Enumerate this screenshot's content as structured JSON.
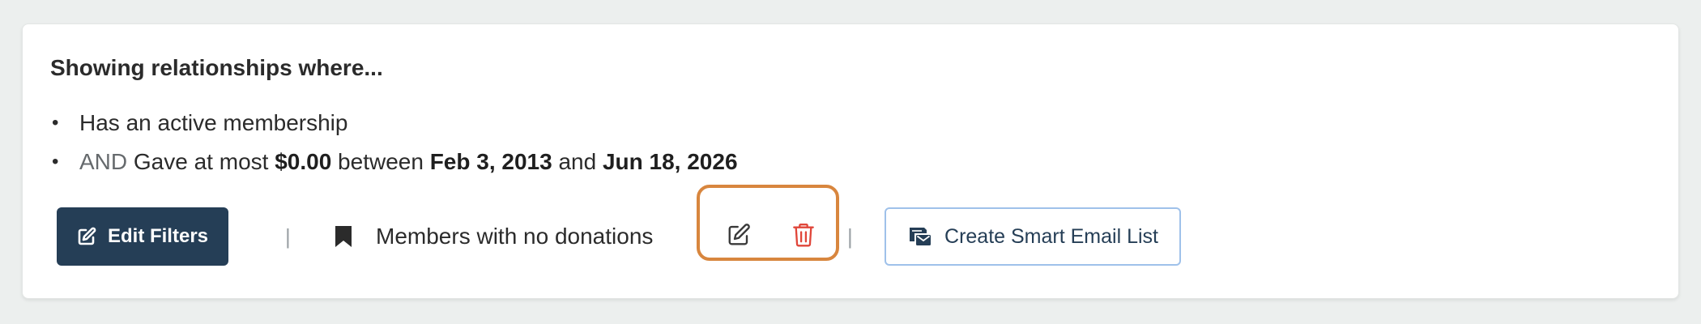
{
  "heading": "Showing relationships where...",
  "conditions": [
    {
      "bullet": "•",
      "text": "Has an active membership"
    },
    {
      "bullet": "•",
      "prefix": "AND",
      "text_before_amount": " Gave at most ",
      "amount": "$0.00",
      "text_between": " between ",
      "start_date": "Feb 3, 2013",
      "text_and": " and ",
      "end_date": "Jun 18, 2026"
    }
  ],
  "actions": {
    "edit_filters_label": "Edit Filters",
    "edit_filters_icon": "edit-square-icon",
    "separator": "|",
    "saved_filter_icon": "bookmark-icon",
    "saved_filter_name": "Members with no donations",
    "edit_saved_filter_icon": "edit-square-icon",
    "delete_saved_filter_icon": "trash-icon",
    "smart_email_icon": "email-list-icon",
    "smart_email_label": "Create Smart Email List"
  },
  "colors": {
    "page_background": "#ecefee",
    "card_background": "#ffffff",
    "primary_button": "#253e56",
    "delete_icon": "#e0463a",
    "highlight_outline": "#d8863e",
    "outline_button_border": "#9fc1ea"
  }
}
